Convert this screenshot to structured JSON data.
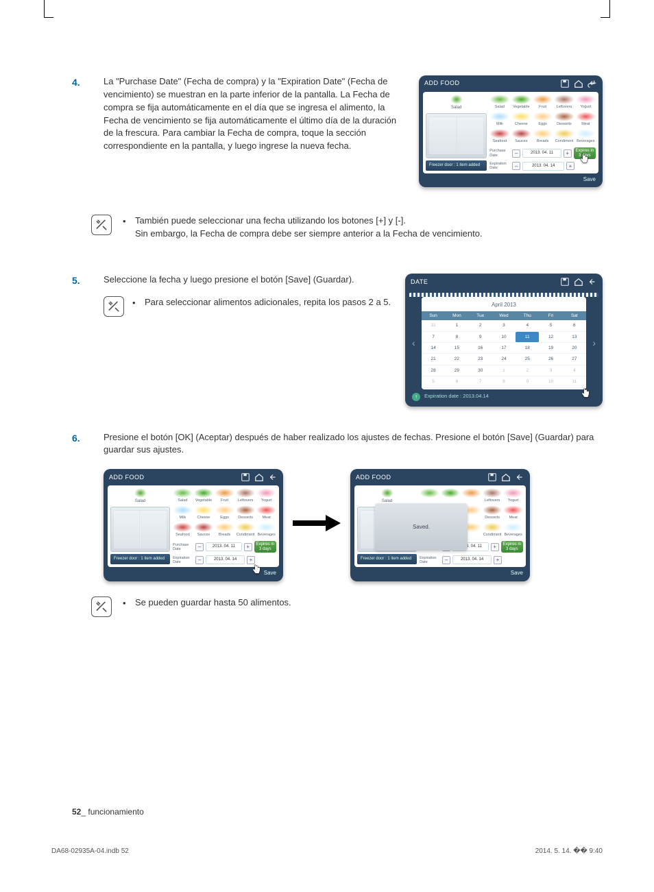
{
  "steps": {
    "s4": {
      "num": "4.",
      "text": "La \"Purchase Date\" (Fecha de compra) y la \"Expiration Date\" (Fecha de vencimiento) se muestran en la parte inferior de la pantalla. La Fecha de compra se fija automáticamente en el día que se ingresa el alimento, la Fecha de vencimiento se fija automáticamente el último día de la duración de la frescura. Para cambiar la Fecha de compra, toque la sección correspondiente en la pantalla, y luego ingrese la nueva fecha."
    },
    "s5": {
      "num": "5.",
      "text": "Seleccione la fecha y luego presione el botón [Save] (Guardar).",
      "sub": "Para seleccionar alimentos adicionales, repita los pasos 2 a 5."
    },
    "s6": {
      "num": "6.",
      "text": "Presione el botón [OK] (Aceptar) después de haber realizado los ajustes de fechas. Presione el botón [Save] (Guardar) para guardar sus ajustes."
    }
  },
  "notes": {
    "n1a": "También puede seleccionar una fecha utilizando los botones [+] y [-].",
    "n1b": "Sin embargo, la Fecha de compra debe ser siempre anterior a la Fecha de vencimiento.",
    "n2": "Se pueden guardar hasta 50 alimentos."
  },
  "mock": {
    "addFoodTitle": "ADD FOOD",
    "dateTitle": "DATE",
    "freezerBar": "Freezer door : 1 item added",
    "purchaseLabel": "Purchase Date",
    "expirationLabel": "Expiration Date",
    "purchaseDate": "2013. 04. 11",
    "expirationDate": "2013. 04. 14",
    "expiresTag1": "Expires in",
    "expiresTag2": "3 days",
    "saveLabel": "Save",
    "savedPopup": "Saved.",
    "saladLabel": "Salad",
    "foodItems": [
      "Salad",
      "Vegetable",
      "Fruit",
      "Leftovers",
      "Yogurt",
      "Milk",
      "Cheese",
      "Eggs",
      "Desserts",
      "Meat",
      "Seafood",
      "Sauces",
      "Breads",
      "Condiment",
      "Beverages"
    ],
    "calendar": {
      "month": "April 2013",
      "dow": [
        "Sun",
        "Mon",
        "Tue",
        "Wed",
        "Thu",
        "Fri",
        "Sat"
      ],
      "footerLabel": "Expiration date : 2013.04.14",
      "leadMute": [
        "31"
      ],
      "days": [
        "1",
        "2",
        "3",
        "4",
        "5",
        "6",
        "7",
        "8",
        "9",
        "10",
        "11",
        "12",
        "13",
        "14",
        "15",
        "16",
        "17",
        "18",
        "19",
        "20",
        "21",
        "22",
        "23",
        "24",
        "25",
        "26",
        "27",
        "28",
        "29",
        "30"
      ],
      "trailMute": [
        "1",
        "2",
        "3",
        "4",
        "5",
        "6",
        "7",
        "8",
        "9",
        "10",
        "11"
      ],
      "selected": "11"
    }
  },
  "footer": {
    "pageNum": "52",
    "section": "_ funcionamiento"
  },
  "printInfo": {
    "file": "DA68-02935A-04.indb   52",
    "date": "2014. 5. 14.   �� 9:40"
  },
  "bulletChar": "•",
  "plus": "+",
  "minus": "–"
}
